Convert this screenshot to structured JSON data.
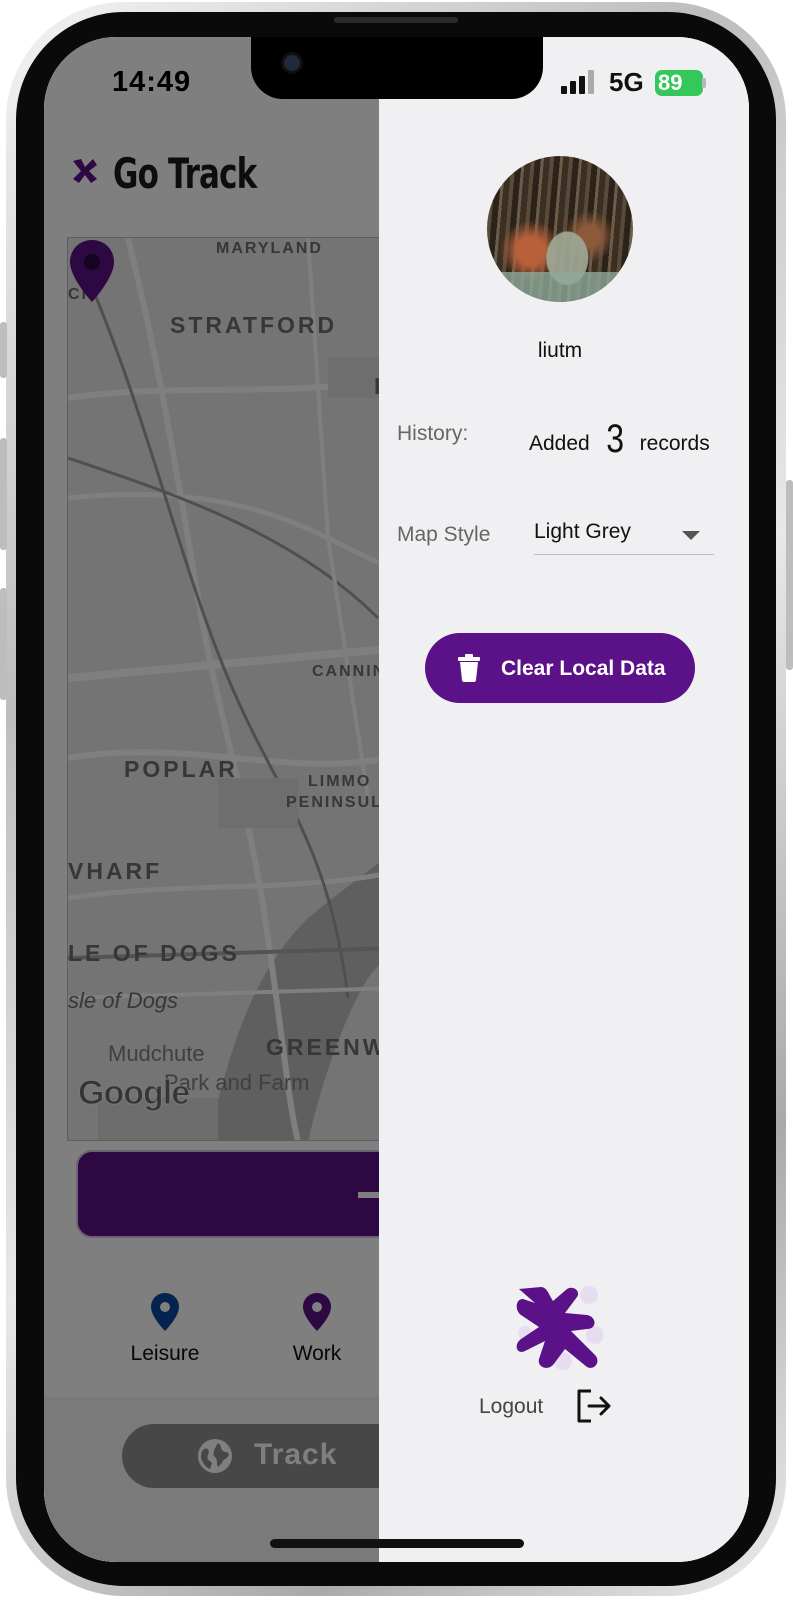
{
  "status_bar": {
    "time": "14:49",
    "network": "5G",
    "battery": "89"
  },
  "app": {
    "title": "Go Track",
    "map": {
      "labels": {
        "maryland": "MARYLAND",
        "ck": "CK",
        "stratford": "STRATFORD",
        "h": "H",
        "cannin": "CANNIN",
        "poplar": "POPLAR",
        "limmo": "LIMMO",
        "peninsula": "PENINSULA",
        "wharf": "VHARF",
        "isle_of_dogs": "LE OF DOGS",
        "isle_of_dogs_station": "sle of Dogs",
        "mudchute": "Mudchute",
        "park_and_farm": "Park and Farm",
        "greenwich": "GREENW"
      },
      "attribution": "Google"
    },
    "categories": [
      {
        "label": "Leisure",
        "color": "#0d47a1"
      },
      {
        "label": "Work",
        "color": "#5b1187"
      }
    ],
    "track_button": "Track"
  },
  "drawer": {
    "username": "liutm",
    "history": {
      "label": "History:",
      "prefix": "Added",
      "count": "3",
      "suffix": "records"
    },
    "map_style": {
      "label": "Map Style",
      "value": "Light Grey"
    },
    "clear_button": "Clear Local Data",
    "logout": "Logout"
  },
  "colors": {
    "brand": "#5b1187",
    "drawer_bg": "#f0eff1",
    "battery": "#34c759"
  }
}
